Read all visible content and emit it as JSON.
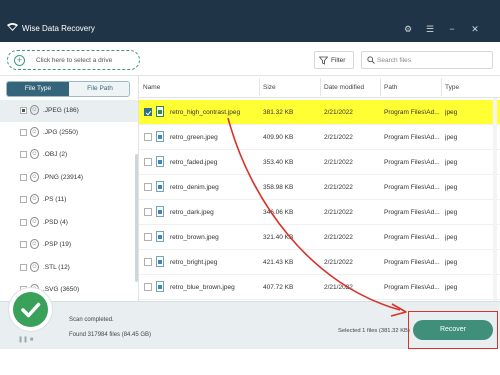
{
  "app": {
    "title": "Wise Data Recovery"
  },
  "window_controls": [
    "settings-icon",
    "menu-icon",
    "minimize-icon",
    "close-icon"
  ],
  "toolbar": {
    "drive_select_label": "Click here to select a drive",
    "filter_label": "Filter",
    "search_placeholder": "Search files"
  },
  "left_panel": {
    "tabs": [
      "File Type",
      "File Path"
    ],
    "active_tab": "File Type",
    "types": [
      {
        "label": ".JPEG (186)",
        "checked": true
      },
      {
        "label": ".JPG (2550)",
        "checked": false
      },
      {
        "label": ".OBJ (2)",
        "checked": false
      },
      {
        "label": ".PNG (23914)",
        "checked": false
      },
      {
        "label": ".PS (11)",
        "checked": false
      },
      {
        "label": ".PSD (4)",
        "checked": false
      },
      {
        "label": ".PSP (19)",
        "checked": false
      },
      {
        "label": ".STL (12)",
        "checked": false
      },
      {
        "label": ".SVG (3650)",
        "checked": false
      }
    ]
  },
  "table": {
    "headers": [
      "Name",
      "Size",
      "Date modified",
      "Path",
      "Type"
    ],
    "rows": [
      {
        "name": "retro_high_contrast.jpeg",
        "size": "381.32 KB",
        "date": "2/21/2022",
        "path": "Program Files\\Ad...",
        "type": "jpeg",
        "selected": true
      },
      {
        "name": "retro_green.jpeg",
        "size": "409.90 KB",
        "date": "2/21/2022",
        "path": "Program Files\\Ad...",
        "type": "jpeg",
        "selected": false
      },
      {
        "name": "retro_faded.jpeg",
        "size": "353.40 KB",
        "date": "2/21/2022",
        "path": "Program Files\\Ad...",
        "type": "jpeg",
        "selected": false
      },
      {
        "name": "retro_denim.jpeg",
        "size": "358.98 KB",
        "date": "2/21/2022",
        "path": "Program Files\\Ad...",
        "type": "jpeg",
        "selected": false
      },
      {
        "name": "retro_dark.jpeg",
        "size": "346.06 KB",
        "date": "2/21/2022",
        "path": "Program Files\\Ad...",
        "type": "jpeg",
        "selected": false
      },
      {
        "name": "retro_brown.jpeg",
        "size": "321.40 KB",
        "date": "2/21/2022",
        "path": "Program Files\\Ad...",
        "type": "jpeg",
        "selected": false
      },
      {
        "name": "retro_bright.jpeg",
        "size": "421.43 KB",
        "date": "2/21/2022",
        "path": "Program Files\\Ad...",
        "type": "jpeg",
        "selected": false
      },
      {
        "name": "retro_blue_brown.jpeg",
        "size": "407.72 KB",
        "date": "2/21/2022",
        "path": "Program Files\\Ad...",
        "type": "jpeg",
        "selected": false
      }
    ]
  },
  "footer": {
    "status": "Scan completed.",
    "found": "Found 317984 files (84.45 GB)",
    "selected_info": "Selected 1 files (381.32 KB)",
    "recover_label": "Recover"
  },
  "colors": {
    "titlebar": "#1f3446",
    "accent": "#3f8f7a",
    "highlight": "#ffff33",
    "annotation": "#d8332b",
    "success": "#3aa15a"
  }
}
